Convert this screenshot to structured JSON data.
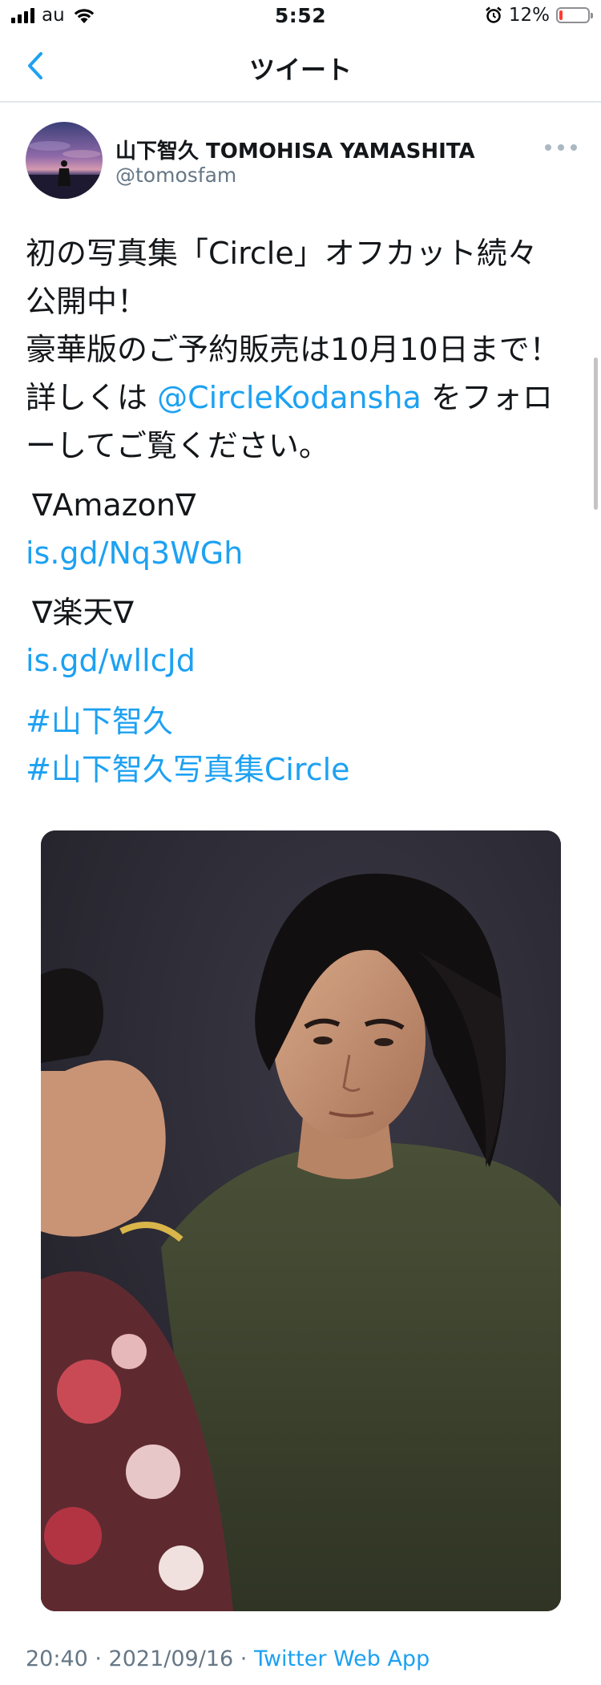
{
  "status_bar": {
    "carrier": "au",
    "time": "5:52",
    "battery_percent": "12%",
    "battery_level": 0.12,
    "icons": [
      "signal-icon",
      "wifi-icon",
      "alarm-icon",
      "battery-icon"
    ]
  },
  "nav": {
    "title": "ツイート",
    "back_icon": "chevron-left-icon"
  },
  "tweet": {
    "author_name": "山下智久 TOMOHISA YAMASHITA",
    "handle": "@tomosfam",
    "more_icon": "ellipsis-icon",
    "text_lines": {
      "l1": "初の写真集「Circle」オフカット続々",
      "l2": "公開中！",
      "l3": "豪華版のご予約販売は10月10日まで！",
      "l4_prefix": "詳しくは ",
      "l4_mention": "@CircleKodansha",
      "l4_suffix": " をフォロ",
      "l5": "ーしてご覧ください。"
    },
    "amazon_label": " ∇Amazon∇",
    "amazon_link": "is.gd/Nq3WGh",
    "rakuten_label": " ∇楽天∇",
    "rakuten_link": "is.gd/wllcJd",
    "hashtags": [
      "#山下智久",
      "#山下智久写真集Circle"
    ],
    "timestamp": "20:40 · 2021/09/16 · ",
    "client": "Twitter Web App"
  },
  "colors": {
    "link": "#1da1f2",
    "secondary_text": "#657786",
    "divider": "#e1e8ed",
    "battery_low": "#ff3b30"
  }
}
